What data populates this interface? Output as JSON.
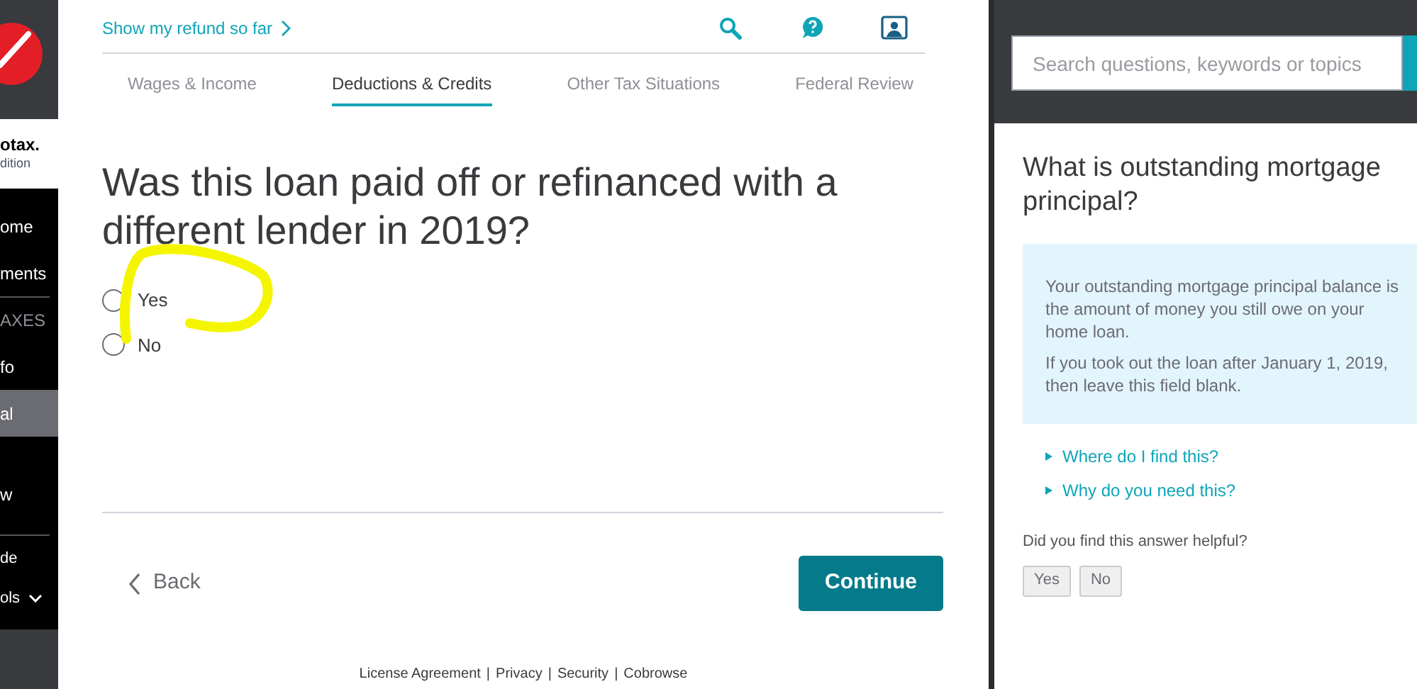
{
  "sidebar": {
    "brand": "otax.",
    "edition": "dition",
    "items": [
      {
        "label": "ome",
        "kind": "link",
        "selected": false
      },
      {
        "label": "ments",
        "kind": "link",
        "selected": false
      },
      {
        "label": "AXES",
        "kind": "heading",
        "selected": false
      },
      {
        "label": "fo",
        "kind": "link",
        "selected": false
      },
      {
        "label": "al",
        "kind": "link",
        "selected": true
      },
      {
        "label": "w",
        "kind": "link",
        "selected": false
      }
    ],
    "bottom_items": [
      {
        "label": "de",
        "kind": "link"
      },
      {
        "label": "ols",
        "kind": "dropdown"
      }
    ]
  },
  "header": {
    "refund_link": "Show my refund so far"
  },
  "tabs": [
    {
      "label": "Wages & Income",
      "selected": false
    },
    {
      "label": "Deductions & Credits",
      "selected": true
    },
    {
      "label": "Other Tax Situations",
      "selected": false
    },
    {
      "label": "Federal Review",
      "selected": false
    }
  ],
  "question": "Was this loan paid off or refinanced with a different lender in 2019?",
  "options": [
    {
      "label": "Yes",
      "selected": false
    },
    {
      "label": "No",
      "selected": false
    }
  ],
  "back_button": "Back",
  "continue_button": "Continue",
  "footer_links": [
    "License Agreement",
    "Privacy",
    "Security",
    "Cobrowse"
  ],
  "footer_separator": "|",
  "help": {
    "search_placeholder": "Search questions, keywords or topics",
    "title": "What is outstanding mortgage principal?",
    "paragraphs": [
      "Your outstanding mortgage principal balance is the amount of money you still owe on your home loan.",
      "If you took out the loan after January 1, 2019, then leave this field blank."
    ],
    "links": [
      "Where do I find this?",
      "Why do you need this?"
    ],
    "feedback_prompt": "Did you find this answer helpful?",
    "feedback_buttons": [
      "Yes",
      "No"
    ]
  }
}
